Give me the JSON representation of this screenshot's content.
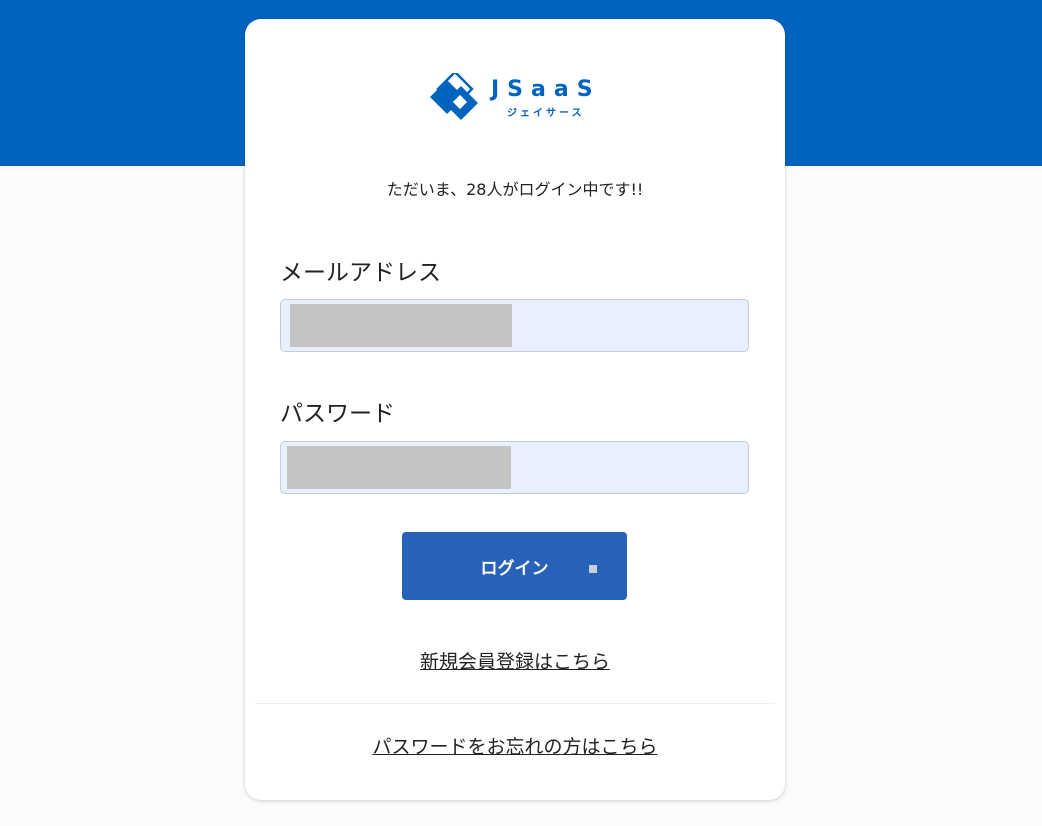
{
  "brand": {
    "logo_word": "JSaaS",
    "logo_kana": "ジェイサース",
    "color": "#0063be"
  },
  "status": {
    "online_message": "ただいま、28人がログイン中です!!"
  },
  "form": {
    "email_label": "メールアドレス",
    "email_value": "",
    "password_label": "パスワード",
    "password_value": "",
    "login_label": "ログイン"
  },
  "links": {
    "register": "新規会員登録はこちら",
    "forgot_password": "パスワードをお忘れの方はこちら"
  },
  "colors": {
    "header_band": "#0063be",
    "button": "#2862b8",
    "input_autofill": "#e8f0fe"
  }
}
